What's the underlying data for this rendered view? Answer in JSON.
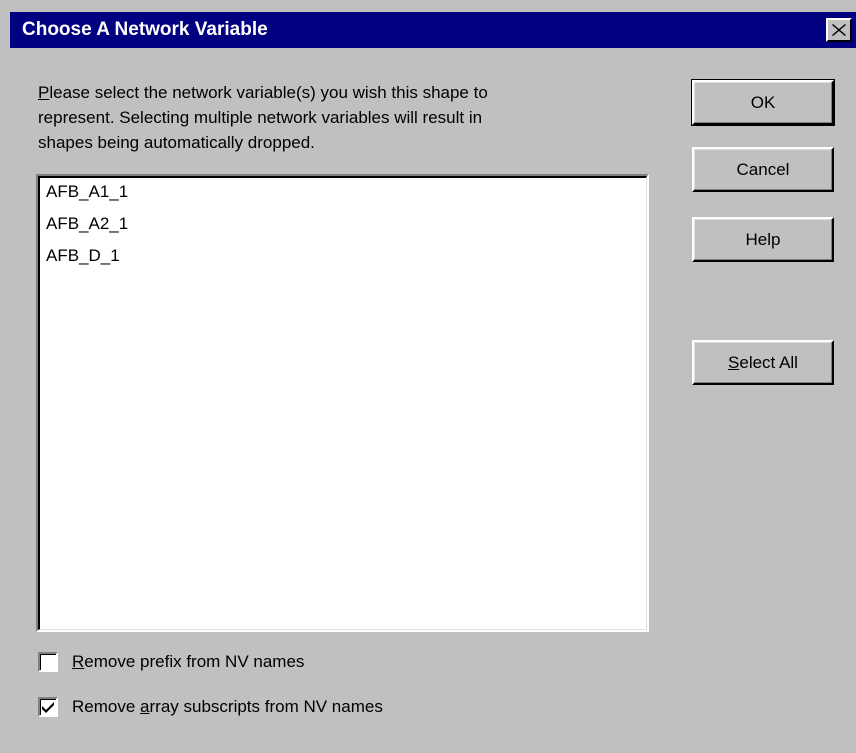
{
  "window": {
    "title": "Choose A Network Variable",
    "close_icon": "close-icon"
  },
  "prompt": {
    "line1_ul": "P",
    "line1_rest": "lease select the network variable(s) you wish this shape to",
    "line2": "represent.  Selecting multiple network variables will result in",
    "line3": "shapes being automatically dropped."
  },
  "list": {
    "items": [
      "AFB_A1_1",
      "AFB_A2_1",
      "AFB_D_1"
    ]
  },
  "buttons": {
    "ok": "OK",
    "cancel": "Cancel",
    "help": "Help",
    "select_all_ul": "S",
    "select_all_rest": "elect All"
  },
  "options": {
    "remove_prefix_ul": "R",
    "remove_prefix_rest": "emove prefix from NV names",
    "remove_prefix_checked": false,
    "remove_array_pre": "Remove ",
    "remove_array_ul": "a",
    "remove_array_rest": "rray subscripts from NV names",
    "remove_array_checked": true
  },
  "colors": {
    "titlebar": "#000080",
    "dialog_bg": "#c0c0c0"
  }
}
